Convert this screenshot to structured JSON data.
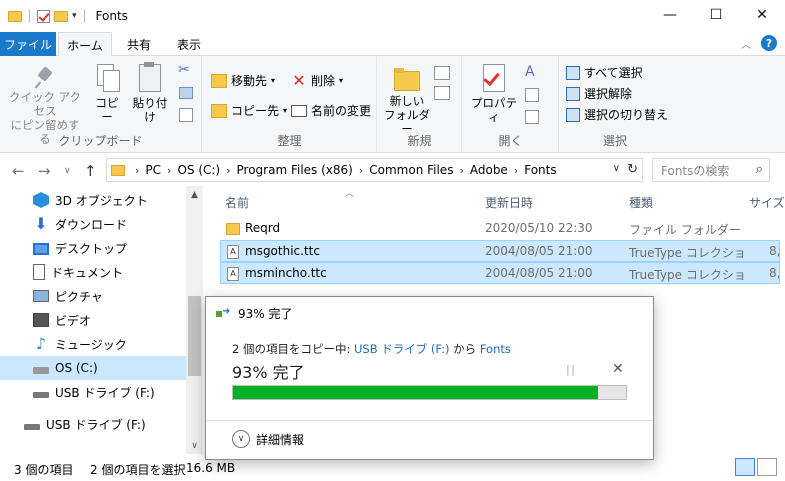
{
  "window": {
    "title": "Fonts",
    "controls": {
      "minimize": "—",
      "maximize": "☐",
      "close": "✕"
    }
  },
  "ribbon_tabs": {
    "file": "ファイル",
    "home": "ホーム",
    "share": "共有",
    "view": "表示",
    "help": "?"
  },
  "ribbon": {
    "clipboard": {
      "label": "クリップボード",
      "pin_line1": "クイック アクセス",
      "pin_line2": "にピン留めする",
      "copy": "コピー",
      "paste": "貼り付け"
    },
    "organize": {
      "label": "整理",
      "move_to": "移動先",
      "copy_to": "コピー先",
      "delete": "削除",
      "rename": "名前の変更"
    },
    "new": {
      "label": "新規",
      "new_folder_line1": "新しい",
      "new_folder_line2": "フォルダー"
    },
    "open": {
      "label": "開く",
      "properties": "プロパティ"
    },
    "select": {
      "label": "選択",
      "select_all": "すべて選択",
      "select_none": "選択解除",
      "invert": "選択の切り替え"
    }
  },
  "address": {
    "crumbs": [
      "PC",
      "OS (C:)",
      "Program Files (x86)",
      "Common Files",
      "Adobe",
      "Fonts"
    ],
    "search_placeholder": "Fontsの検索"
  },
  "nav": {
    "items": [
      {
        "label": "3D オブジェクト",
        "icon": "3d-objects-icon"
      },
      {
        "label": "ダウンロード",
        "icon": "download-icon"
      },
      {
        "label": "デスクトップ",
        "icon": "desktop-icon"
      },
      {
        "label": "ドキュメント",
        "icon": "documents-icon"
      },
      {
        "label": "ピクチャ",
        "icon": "pictures-icon"
      },
      {
        "label": "ビデオ",
        "icon": "videos-icon"
      },
      {
        "label": "ミュージック",
        "icon": "music-icon"
      },
      {
        "label": "OS (C:)",
        "icon": "drive-icon"
      },
      {
        "label": "USB ドライブ (F:)",
        "icon": "usb-drive-icon"
      },
      {
        "label": "USB ドライブ (F:)",
        "icon": "usb-drive-icon"
      }
    ]
  },
  "columns": {
    "name": "名前",
    "date": "更新日時",
    "type": "種類",
    "size": "サイズ"
  },
  "files": [
    {
      "name": "Reqrd",
      "date": "2020/05/10 22:30",
      "type": "ファイル フォルダー",
      "size": ""
    },
    {
      "name": "msgothic.ttc",
      "date": "2004/08/05 21:00",
      "type": "TrueType コレクショ",
      "size": "8,"
    },
    {
      "name": "msmincho.ttc",
      "date": "2004/08/05 21:00",
      "type": "TrueType コレクショ",
      "size": "8,"
    }
  ],
  "status": {
    "item_count": "3 個の項目",
    "selected": "2 個の項目を選択",
    "size": "16.6 MB"
  },
  "copy_dialog": {
    "title": "93% 完了",
    "msg_prefix": "2 個の項目をコピー中: ",
    "source": "USB ドライブ (F:)",
    "msg_mid": " から ",
    "dest": "Fonts",
    "percent_text": "93% 完了",
    "progress": 0.93,
    "details": "詳細情報",
    "progress_color": "#06b025"
  }
}
